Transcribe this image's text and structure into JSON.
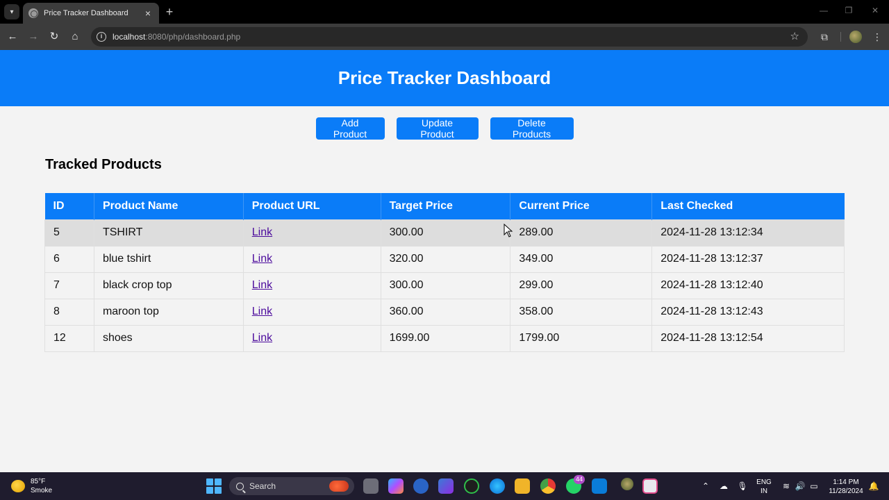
{
  "browser": {
    "tab_title": "Price Tracker Dashboard",
    "url_host": "localhost",
    "url_rest": ":8080/php/dashboard.php"
  },
  "header": {
    "title": "Price Tracker Dashboard"
  },
  "actions": {
    "add": "Add Product",
    "update": "Update Product",
    "delete": "Delete Products"
  },
  "section_title": "Tracked Products",
  "table": {
    "columns": [
      "ID",
      "Product Name",
      "Product URL",
      "Target Price",
      "Current Price",
      "Last Checked"
    ],
    "rows": [
      {
        "id": "5",
        "name": "TSHIRT",
        "url": "Link",
        "target": "300.00",
        "current": "289.00",
        "checked": "2024-11-28 13:12:34"
      },
      {
        "id": "6",
        "name": "blue tshirt",
        "url": "Link",
        "target": "320.00",
        "current": "349.00",
        "checked": "2024-11-28 13:12:37"
      },
      {
        "id": "7",
        "name": "black crop top",
        "url": "Link",
        "target": "300.00",
        "current": "299.00",
        "checked": "2024-11-28 13:12:40"
      },
      {
        "id": "8",
        "name": "maroon top",
        "url": "Link",
        "target": "360.00",
        "current": "358.00",
        "checked": "2024-11-28 13:12:43"
      },
      {
        "id": "12",
        "name": "shoes",
        "url": "Link",
        "target": "1699.00",
        "current": "1799.00",
        "checked": "2024-11-28 13:12:54"
      }
    ]
  },
  "taskbar": {
    "weather_temp": "85°F",
    "weather_desc": "Smoke",
    "search_placeholder": "Search",
    "whatsapp_badge": "44",
    "lang_top": "ENG",
    "lang_bottom": "IN",
    "time": "1:14 PM",
    "date": "11/28/2024"
  },
  "colors": {
    "accent": "#0a7cf8",
    "link": "#4b0a9c",
    "hover_row": "#dddddd"
  }
}
